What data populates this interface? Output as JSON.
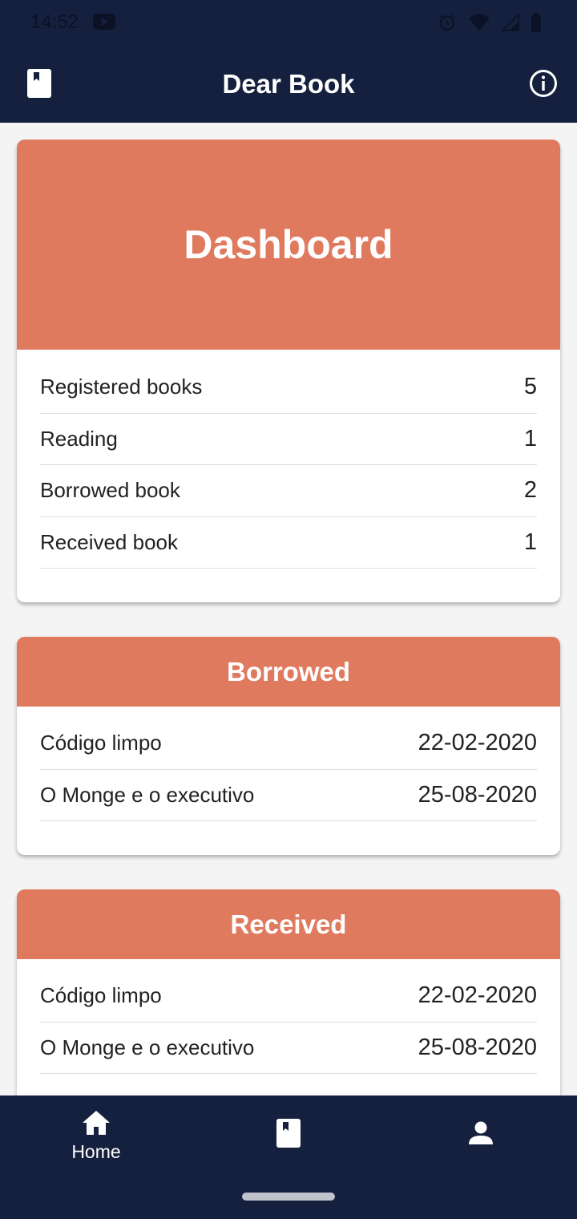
{
  "status_bar": {
    "time": "14:52"
  },
  "app_bar": {
    "title": "Dear Book"
  },
  "dashboard": {
    "title": "Dashboard",
    "rows": [
      {
        "label": "Registered books",
        "value": "5"
      },
      {
        "label": "Reading",
        "value": "1"
      },
      {
        "label": "Borrowed book",
        "value": "2"
      },
      {
        "label": "Received book",
        "value": "1"
      }
    ]
  },
  "borrowed": {
    "title": "Borrowed",
    "rows": [
      {
        "label": "Código limpo",
        "value": "22-02-2020"
      },
      {
        "label": "O Monge e o executivo",
        "value": "25-08-2020"
      }
    ]
  },
  "received": {
    "title": "Received",
    "rows": [
      {
        "label": "Código limpo",
        "value": "22-02-2020"
      },
      {
        "label": "O Monge e o executivo",
        "value": "25-08-2020"
      }
    ]
  },
  "bottom_nav": {
    "home_label": "Home",
    "icons": [
      "home-icon",
      "book-icon",
      "person-icon"
    ]
  },
  "colors": {
    "primary_dark": "#14203d",
    "accent": "#df7a5f"
  }
}
